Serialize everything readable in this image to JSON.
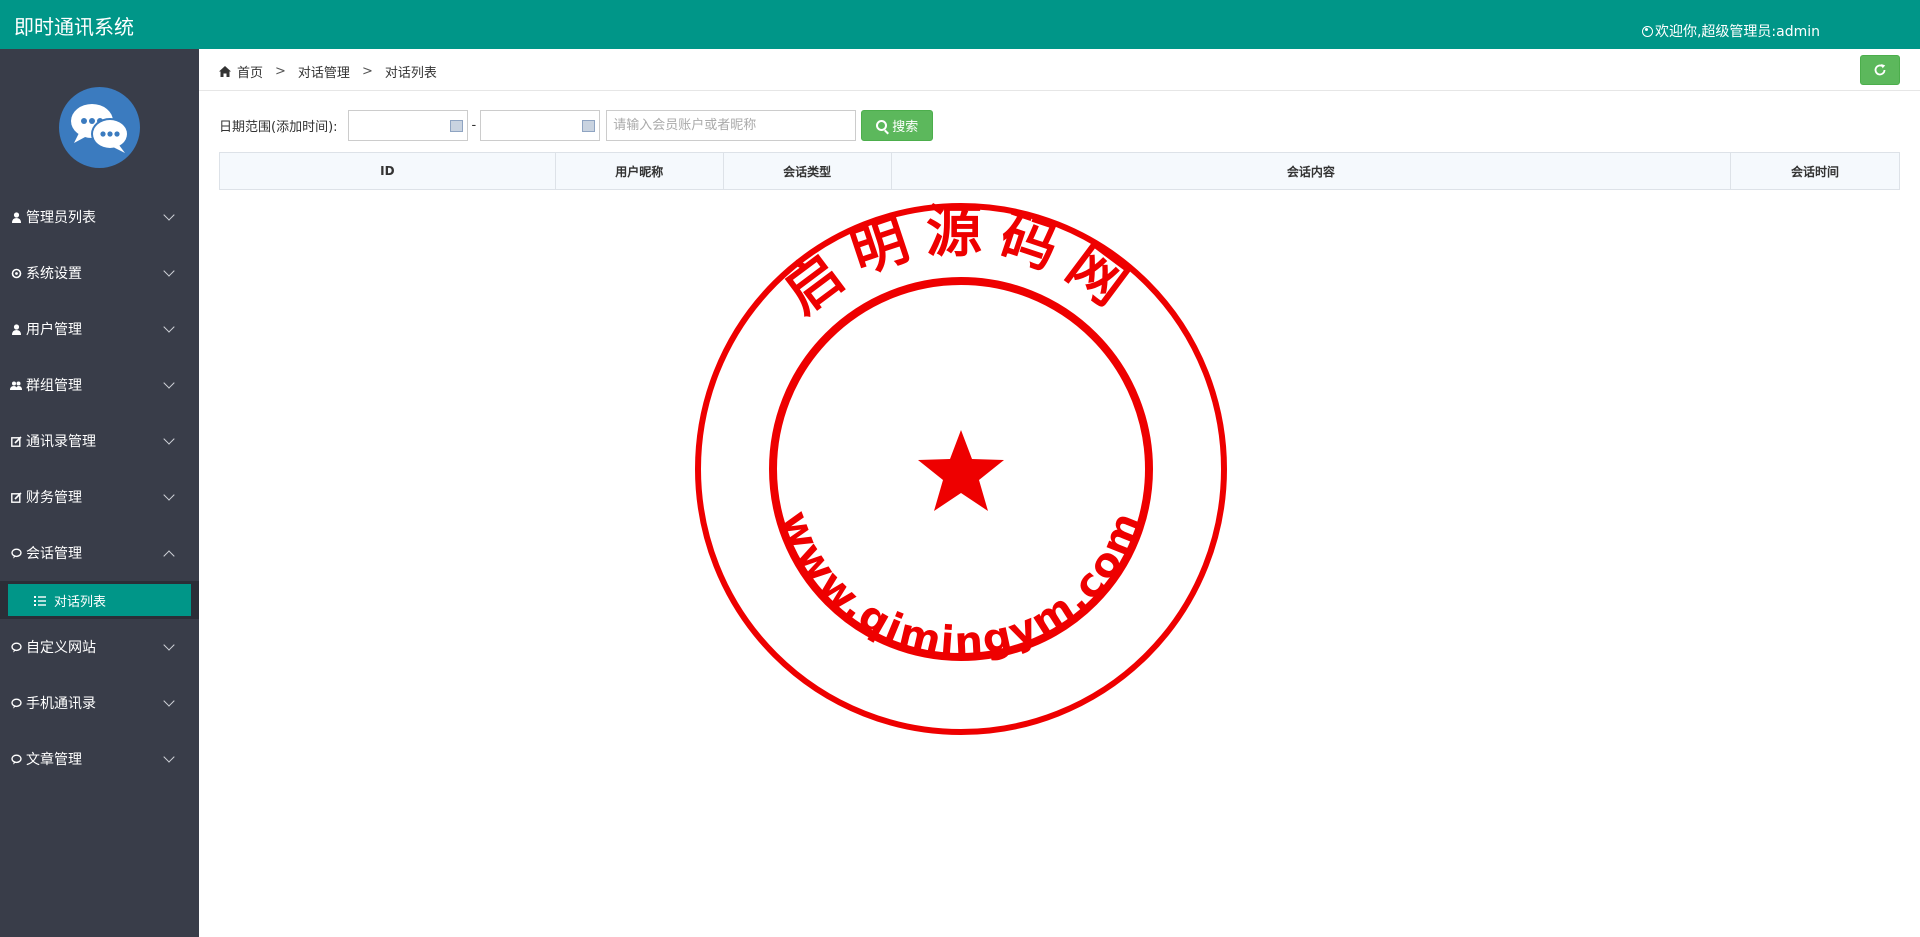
{
  "header": {
    "app_title": "即时通讯系统",
    "welcome": "欢迎你,超级管理员:admin"
  },
  "sidebar": {
    "items": [
      {
        "label": "管理员列表",
        "icon": "user-icon"
      },
      {
        "label": "系统设置",
        "icon": "gear-icon"
      },
      {
        "label": "用户管理",
        "icon": "user-icon"
      },
      {
        "label": "群组管理",
        "icon": "group-icon"
      },
      {
        "label": "通讯录管理",
        "icon": "edit-icon"
      },
      {
        "label": "财务管理",
        "icon": "edit-icon"
      },
      {
        "label": "会话管理",
        "icon": "chat-icon",
        "expanded": true
      },
      {
        "label": "自定义网站",
        "icon": "chat-icon"
      },
      {
        "label": "手机通讯录",
        "icon": "chat-icon"
      },
      {
        "label": "文章管理",
        "icon": "chat-icon"
      }
    ],
    "active_sub": "对话列表"
  },
  "breadcrumb": [
    "首页",
    "对话管理",
    "对话列表"
  ],
  "breadcrumb_sep": ">",
  "filter": {
    "date_label": "日期范围(添加时间):",
    "date_from": "",
    "date_to": "",
    "range_sep": "-",
    "search_placeholder": "请输入会员账户或者昵称",
    "search_value": "",
    "search_button": "搜索"
  },
  "table": {
    "columns": [
      "ID",
      "用户昵称",
      "会话类型",
      "会话内容",
      "会话时间"
    ],
    "rows": []
  },
  "watermark": {
    "top_text": "启明源码网",
    "bottom_text": "www.qimingym.com"
  },
  "colors": {
    "topbar": "#009688",
    "sidebar": "#393d49",
    "active": "#009688",
    "button": "#5cb85c",
    "seal": "#ee0000"
  }
}
